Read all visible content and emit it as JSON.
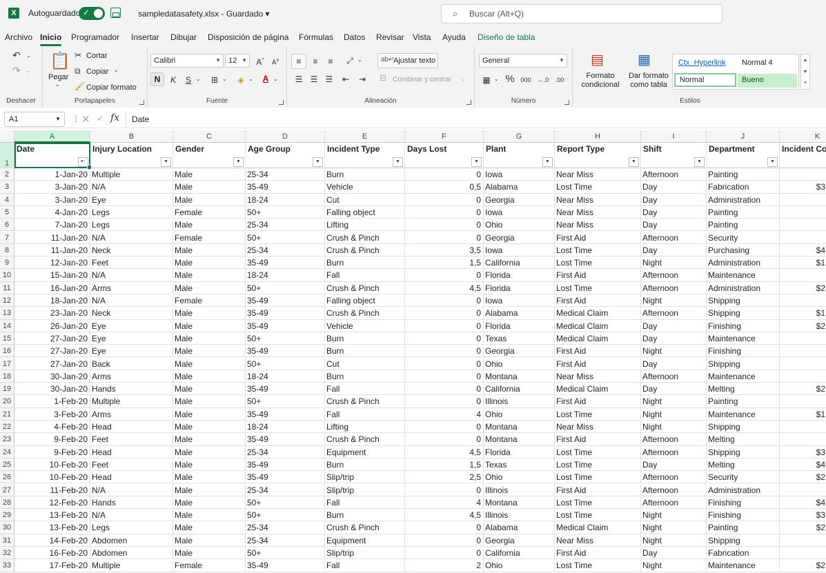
{
  "titlebar": {
    "logo": "X",
    "autosave_label": "Autoguardado",
    "file_title": "sampledatasafety.xlsx  -  Guardado  ▾",
    "search_placeholder": "Buscar (Alt+Q)"
  },
  "menu_tabs": [
    "Archivo",
    "Inicio",
    "Programador",
    "Insertar",
    "Dibujar",
    "Disposición de página",
    "Fórmulas",
    "Datos",
    "Revisar",
    "Vista",
    "Ayuda",
    "Diseño de tabla"
  ],
  "ribbon": {
    "undo_group": "Deshacer",
    "clipboard": {
      "paste": "Pegar",
      "cut": "Cortar",
      "copy": "Copiar",
      "copy_format": "Copiar formato",
      "label": "Portapapeles"
    },
    "font": {
      "name": "Calibri",
      "size": "12",
      "bold": "N",
      "italic": "K",
      "underline": "S",
      "label": "Fuente"
    },
    "alignment": {
      "wrap": "Ajustar texto",
      "merge": "Combinar y centrar",
      "label": "Alineación"
    },
    "number": {
      "format": "General",
      "percent": "%",
      "thousands": "000",
      "label": "Número"
    },
    "styles": {
      "cond_format": "Formato condicional",
      "table_format": "Dar formato como tabla",
      "hyperlink": "Ctx_Hyperlink",
      "normal4": "Normal 4",
      "normal": "Normal",
      "good": "Bueno",
      "label": "Estilos"
    }
  },
  "formula_bar": {
    "cell_ref": "A1",
    "content": "Date"
  },
  "columns": [
    "A",
    "B",
    "C",
    "D",
    "E",
    "F",
    "G",
    "H",
    "I",
    "J",
    "K"
  ],
  "headers": [
    "Date",
    "Injury Location",
    "Gender",
    "Age Group",
    "Incident Type",
    "Days Lost",
    "Plant",
    "Report Type",
    "Shift",
    "Department",
    "Incident Co"
  ],
  "rows": [
    [
      "1-Jan-20",
      "Multiple",
      "Male",
      "25-34",
      "Burn",
      "0",
      "Iowa",
      "Near Miss",
      "Afternoon",
      "Painting",
      ""
    ],
    [
      "3-Jan-20",
      "N/A",
      "Male",
      "35-49",
      "Vehicle",
      "0,5",
      "Alabama",
      "Lost Time",
      "Day",
      "Fabrication",
      "$3"
    ],
    [
      "3-Jan-20",
      "Eye",
      "Male",
      "18-24",
      "Cut",
      "0",
      "Georgia",
      "Near Miss",
      "Day",
      "Administration",
      ""
    ],
    [
      "4-Jan-20",
      "Legs",
      "Female",
      "50+",
      "Falling object",
      "0",
      "Iowa",
      "Near Miss",
      "Day",
      "Painting",
      ""
    ],
    [
      "7-Jan-20",
      "Legs",
      "Male",
      "25-34",
      "Lifting",
      "0",
      "Ohio",
      "Near Miss",
      "Day",
      "Painting",
      ""
    ],
    [
      "11-Jan-20",
      "N/A",
      "Female",
      "50+",
      "Crush & Pinch",
      "0",
      "Georgia",
      "First Aid",
      "Afternoon",
      "Security",
      ""
    ],
    [
      "11-Jan-20",
      "Neck",
      "Male",
      "25-34",
      "Crush & Pinch",
      "3,5",
      "Iowa",
      "Lost Time",
      "Day",
      "Purchasing",
      "$4"
    ],
    [
      "12-Jan-20",
      "Feet",
      "Male",
      "35-49",
      "Burn",
      "1,5",
      "California",
      "Lost Time",
      "Night",
      "Administration",
      "$1"
    ],
    [
      "15-Jan-20",
      "N/A",
      "Male",
      "18-24",
      "Fall",
      "0",
      "Florida",
      "First Aid",
      "Afternoon",
      "Maintenance",
      ""
    ],
    [
      "16-Jan-20",
      "Arms",
      "Male",
      "50+",
      "Crush & Pinch",
      "4,5",
      "Florida",
      "Lost Time",
      "Afternoon",
      "Administration",
      "$2"
    ],
    [
      "18-Jan-20",
      "N/A",
      "Female",
      "35-49",
      "Falling object",
      "0",
      "Iowa",
      "First Aid",
      "Night",
      "Shipping",
      ""
    ],
    [
      "23-Jan-20",
      "Neck",
      "Male",
      "35-49",
      "Crush & Pinch",
      "0",
      "Alabama",
      "Medical Claim",
      "Afternoon",
      "Shipping",
      "$1"
    ],
    [
      "26-Jan-20",
      "Eye",
      "Male",
      "35-49",
      "Vehicle",
      "0",
      "Florida",
      "Medical Claim",
      "Day",
      "Finishing",
      "$2"
    ],
    [
      "27-Jan-20",
      "Eye",
      "Male",
      "50+",
      "Burn",
      "0",
      "Texas",
      "Medical Claim",
      "Day",
      "Maintenance",
      ""
    ],
    [
      "27-Jan-20",
      "Eye",
      "Male",
      "35-49",
      "Burn",
      "0",
      "Georgia",
      "First Aid",
      "Night",
      "Finishing",
      ""
    ],
    [
      "27-Jan-20",
      "Back",
      "Male",
      "50+",
      "Cut",
      "0",
      "Ohio",
      "First Aid",
      "Day",
      "Shipping",
      ""
    ],
    [
      "30-Jan-20",
      "Arms",
      "Male",
      "18-24",
      "Burn",
      "0",
      "Montana",
      "Near Miss",
      "Afternoon",
      "Maintenance",
      ""
    ],
    [
      "30-Jan-20",
      "Hands",
      "Male",
      "35-49",
      "Fall",
      "0",
      "California",
      "Medical Claim",
      "Day",
      "Melting",
      "$2"
    ],
    [
      "1-Feb-20",
      "Multiple",
      "Male",
      "50+",
      "Crush & Pinch",
      "0",
      "Illinois",
      "First Aid",
      "Night",
      "Painting",
      ""
    ],
    [
      "3-Feb-20",
      "Arms",
      "Male",
      "35-49",
      "Fall",
      "4",
      "Ohio",
      "Lost Time",
      "Night",
      "Maintenance",
      "$1"
    ],
    [
      "4-Feb-20",
      "Head",
      "Male",
      "18-24",
      "Lifting",
      "0",
      "Montana",
      "Near Miss",
      "Night",
      "Shipping",
      ""
    ],
    [
      "9-Feb-20",
      "Feet",
      "Male",
      "35-49",
      "Crush & Pinch",
      "0",
      "Montana",
      "First Aid",
      "Afternoon",
      "Melting",
      ""
    ],
    [
      "9-Feb-20",
      "Head",
      "Male",
      "25-34",
      "Equipment",
      "4,5",
      "Florida",
      "Lost Time",
      "Afternoon",
      "Shipping",
      "$3"
    ],
    [
      "10-Feb-20",
      "Feet",
      "Male",
      "35-49",
      "Burn",
      "1,5",
      "Texas",
      "Lost Time",
      "Day",
      "Melting",
      "$4"
    ],
    [
      "10-Feb-20",
      "Head",
      "Male",
      "35-49",
      "Slip/trip",
      "2,5",
      "Ohio",
      "Lost Time",
      "Afternoon",
      "Security",
      "$2"
    ],
    [
      "11-Feb-20",
      "N/A",
      "Male",
      "25-34",
      "Slip/trip",
      "0",
      "Illinois",
      "First Aid",
      "Afternoon",
      "Administration",
      ""
    ],
    [
      "12-Feb-20",
      "Hands",
      "Male",
      "50+",
      "Fall",
      "4",
      "Montana",
      "Lost Time",
      "Afternoon",
      "Finishing",
      "$4"
    ],
    [
      "13-Feb-20",
      "N/A",
      "Male",
      "50+",
      "Burn",
      "4,5",
      "Illinois",
      "Lost Time",
      "Night",
      "Finishing",
      "$3"
    ],
    [
      "13-Feb-20",
      "Legs",
      "Male",
      "25-34",
      "Crush & Pinch",
      "0",
      "Alabama",
      "Medical Claim",
      "Night",
      "Painting",
      "$2"
    ],
    [
      "14-Feb-20",
      "Abdomen",
      "Male",
      "25-34",
      "Equipment",
      "0",
      "Georgia",
      "Near Miss",
      "Night",
      "Shipping",
      ""
    ],
    [
      "16-Feb-20",
      "Abdomen",
      "Male",
      "50+",
      "Slip/trip",
      "0",
      "California",
      "First Aid",
      "Day",
      "Fabrication",
      ""
    ],
    [
      "17-Feb-20",
      "Multiple",
      "Female",
      "35-49",
      "Fall",
      "2",
      "Ohio",
      "Lost Time",
      "Night",
      "Maintenance",
      "$2"
    ]
  ]
}
